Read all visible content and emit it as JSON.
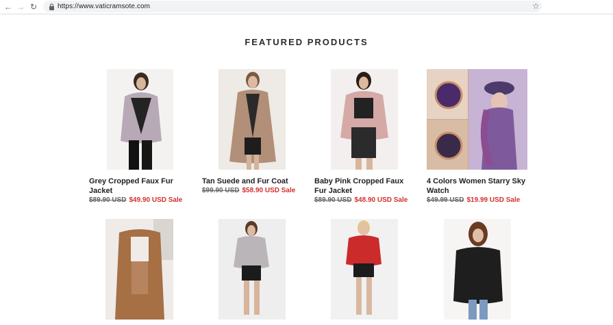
{
  "browser": {
    "url": "https://www.vaticramsote.com"
  },
  "section": {
    "title": "FEATURED PRODUCTS"
  },
  "products": [
    {
      "name": "Grey Cropped Faux Fur Jacket",
      "original_price": "$89.90 USD",
      "sale_price": "$49.90 USD Sale"
    },
    {
      "name": "Tan Suede and Fur Coat",
      "original_price": "$99.90 USD",
      "sale_price": "$58.90 USD Sale"
    },
    {
      "name": "Baby Pink Cropped Faux Fur Jacket",
      "original_price": "$89.90 USD",
      "sale_price": "$48.90 USD Sale"
    },
    {
      "name": "4 Colors Women Starry Sky Watch",
      "original_price": "$49.99 USD",
      "sale_price": "$19.99 USD Sale"
    },
    {
      "name": "",
      "original_price": "",
      "sale_price": ""
    },
    {
      "name": "",
      "original_price": "",
      "sale_price": ""
    },
    {
      "name": "",
      "original_price": "",
      "sale_price": ""
    },
    {
      "name": "",
      "original_price": "",
      "sale_price": ""
    }
  ],
  "colors": {
    "sale": "#d32f2f",
    "strike": "#666666"
  }
}
